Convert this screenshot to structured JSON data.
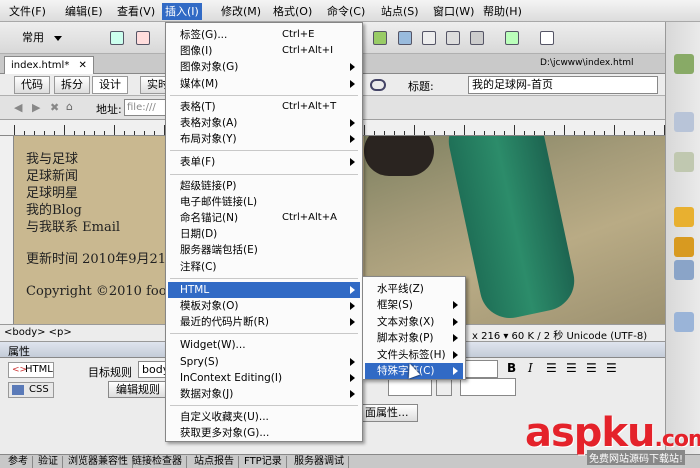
{
  "menubar": {
    "items": [
      "文件(F)",
      "编辑(E)",
      "查看(V)",
      "插入(I)",
      "修改(M)",
      "格式(O)",
      "命令(C)",
      "站点(S)",
      "窗口(W)",
      "帮助(H)"
    ]
  },
  "toolbar": {
    "category_label": "常用"
  },
  "document": {
    "tab_label": "index.html*",
    "path": "D:\\jcwww\\index.html",
    "view_buttons": [
      "代码",
      "拆分",
      "设计",
      "实时"
    ],
    "address_label": "地址:",
    "address_value": "file:///",
    "title_label": "标题:",
    "title_value": "我的足球网-首页"
  },
  "page": {
    "nav_lines": [
      "我与足球",
      "足球新闻",
      "足球明星",
      "我的Blog",
      "与我联系 Email"
    ],
    "update_line": "更新时间 2010年9月21",
    "copyright": "Copyright ©2010 football"
  },
  "statusbar": {
    "tags": "<body> <p>",
    "size_info": "x 216 ▾ 60 K / 2 秒  Unicode (UTF-8)"
  },
  "properties": {
    "header": "属性",
    "html_button": "HTML",
    "css_button": "CSS",
    "target_rule_label": "目标规则",
    "target_rule_value": "body",
    "edit_rule_button": "编辑规则",
    "page_props_button": "面属性..."
  },
  "insert_menu": {
    "groups": [
      [
        {
          "label": "标签(G)...",
          "shortcut": "Ctrl+E"
        },
        {
          "label": "图像(I)",
          "shortcut": "Ctrl+Alt+I"
        },
        {
          "label": "图像对象(G)",
          "submenu": true
        },
        {
          "label": "媒体(M)",
          "submenu": true
        }
      ],
      [
        {
          "label": "表格(T)",
          "shortcut": "Ctrl+Alt+T"
        },
        {
          "label": "表格对象(A)",
          "submenu": true
        },
        {
          "label": "布局对象(Y)",
          "submenu": true
        }
      ],
      [
        {
          "label": "表单(F)",
          "submenu": true
        }
      ],
      [
        {
          "label": "超级链接(P)"
        },
        {
          "label": "电子邮件链接(L)"
        },
        {
          "label": "命名锚记(N)",
          "shortcut": "Ctrl+Alt+A"
        },
        {
          "label": "日期(D)"
        },
        {
          "label": "服务器端包括(E)"
        },
        {
          "label": "注释(C)"
        }
      ],
      [
        {
          "label": "HTML",
          "submenu": true,
          "highlighted": true
        },
        {
          "label": "模板对象(O)",
          "submenu": true
        },
        {
          "label": "最近的代码片断(R)",
          "submenu": true
        }
      ],
      [
        {
          "label": "Widget(W)..."
        },
        {
          "label": "Spry(S)",
          "submenu": true
        },
        {
          "label": "InContext Editing(I)",
          "submenu": true
        },
        {
          "label": "数据对象(J)",
          "submenu": true
        }
      ],
      [
        {
          "label": "自定义收藏夹(U)..."
        },
        {
          "label": "获取更多对象(G)..."
        }
      ]
    ]
  },
  "html_submenu": {
    "items": [
      {
        "label": "水平线(Z)"
      },
      {
        "label": "框架(S)",
        "submenu": true
      },
      {
        "label": "文本对象(X)",
        "submenu": true
      },
      {
        "label": "脚本对象(P)",
        "submenu": true
      },
      {
        "label": "文件头标签(H)",
        "submenu": true
      },
      {
        "label": "特殊字符(C)",
        "submenu": true,
        "highlighted": true
      }
    ]
  },
  "bottom_tabs": [
    "参考",
    "验证",
    "浏览器兼容性",
    "链接检查器",
    "站点报告",
    "FTP记录",
    "服务器调试"
  ],
  "watermark": {
    "text": "aspku",
    "suffix": ".com",
    "subtitle": "免费网站源码下载站!"
  }
}
